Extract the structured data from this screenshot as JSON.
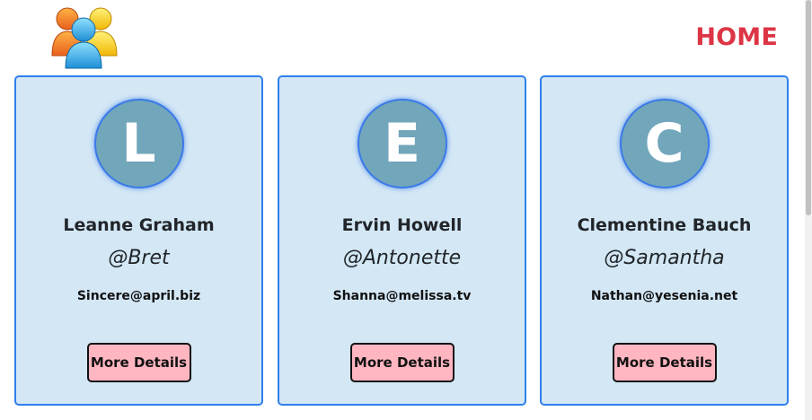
{
  "header": {
    "logo_icon": "users-group-logo-icon",
    "home_label": "HOME"
  },
  "colors": {
    "home": "#dc3545",
    "card_bg": "#d3e7f5",
    "card_border": "#2f80ed",
    "avatar_bg": "#72a6bb",
    "button_bg": "#ffb6c1"
  },
  "users": [
    {
      "initial": "L",
      "name": "Leanne Graham",
      "username": "@Bret",
      "email": "Sincere@april.biz",
      "button_label": "More Details"
    },
    {
      "initial": "E",
      "name": "Ervin Howell",
      "username": "@Antonette",
      "email": "Shanna@melissa.tv",
      "button_label": "More Details"
    },
    {
      "initial": "C",
      "name": "Clementine Bauch",
      "username": "@Samantha",
      "email": "Nathan@yesenia.net",
      "button_label": "More Details"
    }
  ]
}
